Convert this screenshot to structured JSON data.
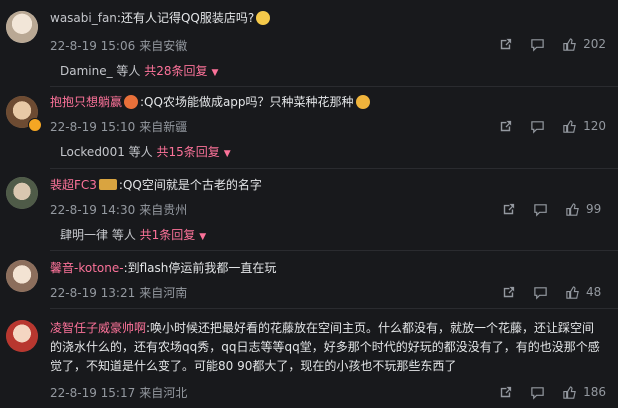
{
  "comments": [
    {
      "user": "wasabi_fan",
      "text": ":还有人记得QQ服装店吗?",
      "date": "22-8-19 15:06",
      "location": "来自安徽",
      "likes": "202",
      "reply_user": "Damine_",
      "reply_mid": " 等人 ",
      "reply_count": "共28条回复"
    },
    {
      "user": "抱抱只想躺赢",
      "text": ":QQ农场能做成app吗？只种菜种花那种",
      "date": "22-8-19 15:10",
      "location": "来自新疆",
      "likes": "120",
      "reply_user": "Locked001",
      "reply_mid": " 等人 ",
      "reply_count": "共15条回复"
    },
    {
      "user": "裴超FC3",
      "text": ":QQ空间就是个古老的名字",
      "date": "22-8-19 14:30",
      "location": "来自贵州",
      "likes": "99",
      "reply_user": "肆明一律",
      "reply_mid": " 等人 ",
      "reply_count": "共1条回复"
    },
    {
      "user": "馨音-kotone-",
      "text": ":到flash停运前我都一直在玩",
      "date": "22-8-19 13:21",
      "location": "来自河南",
      "likes": "48"
    },
    {
      "user": "凌智任子威豪帅啊",
      "text": ":唤小时候还把最好看的花藤放在空间主页。什么都没有，就放一个花藤，还让踩空间的浇水什么的，还有农场qq秀，qq日志等等qq堂，好多那个时代的好玩的都没没有了，有的也没那个感觉了，不知道是什么变了。可能80 90都大了，现在的小孩也不玩那些东西了",
      "date": "22-8-19 15:17",
      "location": "来自河北",
      "likes": "186"
    }
  ],
  "colors": {
    "bg": "#18191c",
    "accent": "#fb7299",
    "meta": "#9499a0"
  },
  "icons": [
    "share-icon",
    "comment-icon",
    "like-icon"
  ]
}
